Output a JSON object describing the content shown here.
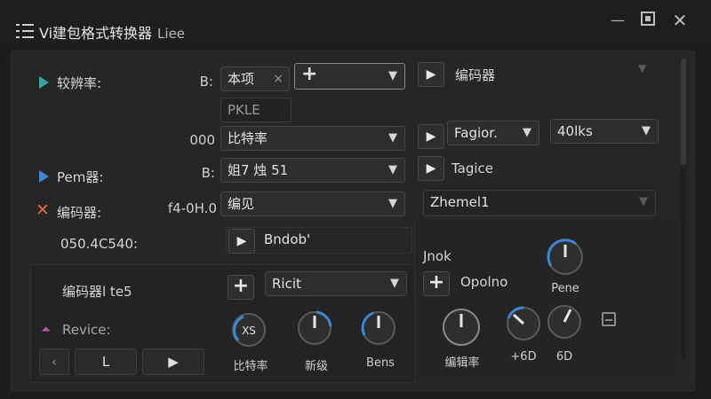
{
  "window": {
    "title": "Vi建包格式转换器",
    "title_sub": "Liee",
    "minimize_glyph": "—",
    "close_glyph": "✕"
  },
  "form": {
    "row1": {
      "label": "较辨率:",
      "value_prefix": "B:",
      "field_value": "本项",
      "clear_glyph": "×",
      "right_button_label": "编码器"
    },
    "hint": "PKLE",
    "row2": {
      "value_prefix": "000",
      "field_value": "比特率",
      "right_field_1": "Fagior.",
      "right_field_2": "40lks"
    },
    "row3": {
      "label": "Pem器:",
      "value_prefix": "B:",
      "field_value": "姐7 烛 51",
      "right_label": "Tagice"
    },
    "row4": {
      "label": "编码器:",
      "value_prefix": "f4-0H.0",
      "field_value": "编见",
      "right_field": "Zhemel1"
    },
    "row5": {
      "label": "050.4C540:",
      "button_label": "Bndob'"
    }
  },
  "subpanel": {
    "label": "编码器l te5",
    "select_value": "Ricit",
    "revice_label": "Revice:",
    "nav_left": "L",
    "knobs": [
      {
        "label": "比特率",
        "text": "XS"
      },
      {
        "label": "新级",
        "text": ""
      },
      {
        "label": "Bens",
        "text": ""
      }
    ]
  },
  "rightpanel": {
    "header": "Jnok",
    "button_label": "Opolno",
    "knobs": [
      {
        "label": "Pene"
      },
      {
        "label": "编辑率"
      },
      {
        "label": "+6D"
      },
      {
        "label": "6D"
      }
    ]
  },
  "colors": {
    "accent_blue": "#3e86d6",
    "teal": "#3aa6a0",
    "red": "#d9684c"
  }
}
